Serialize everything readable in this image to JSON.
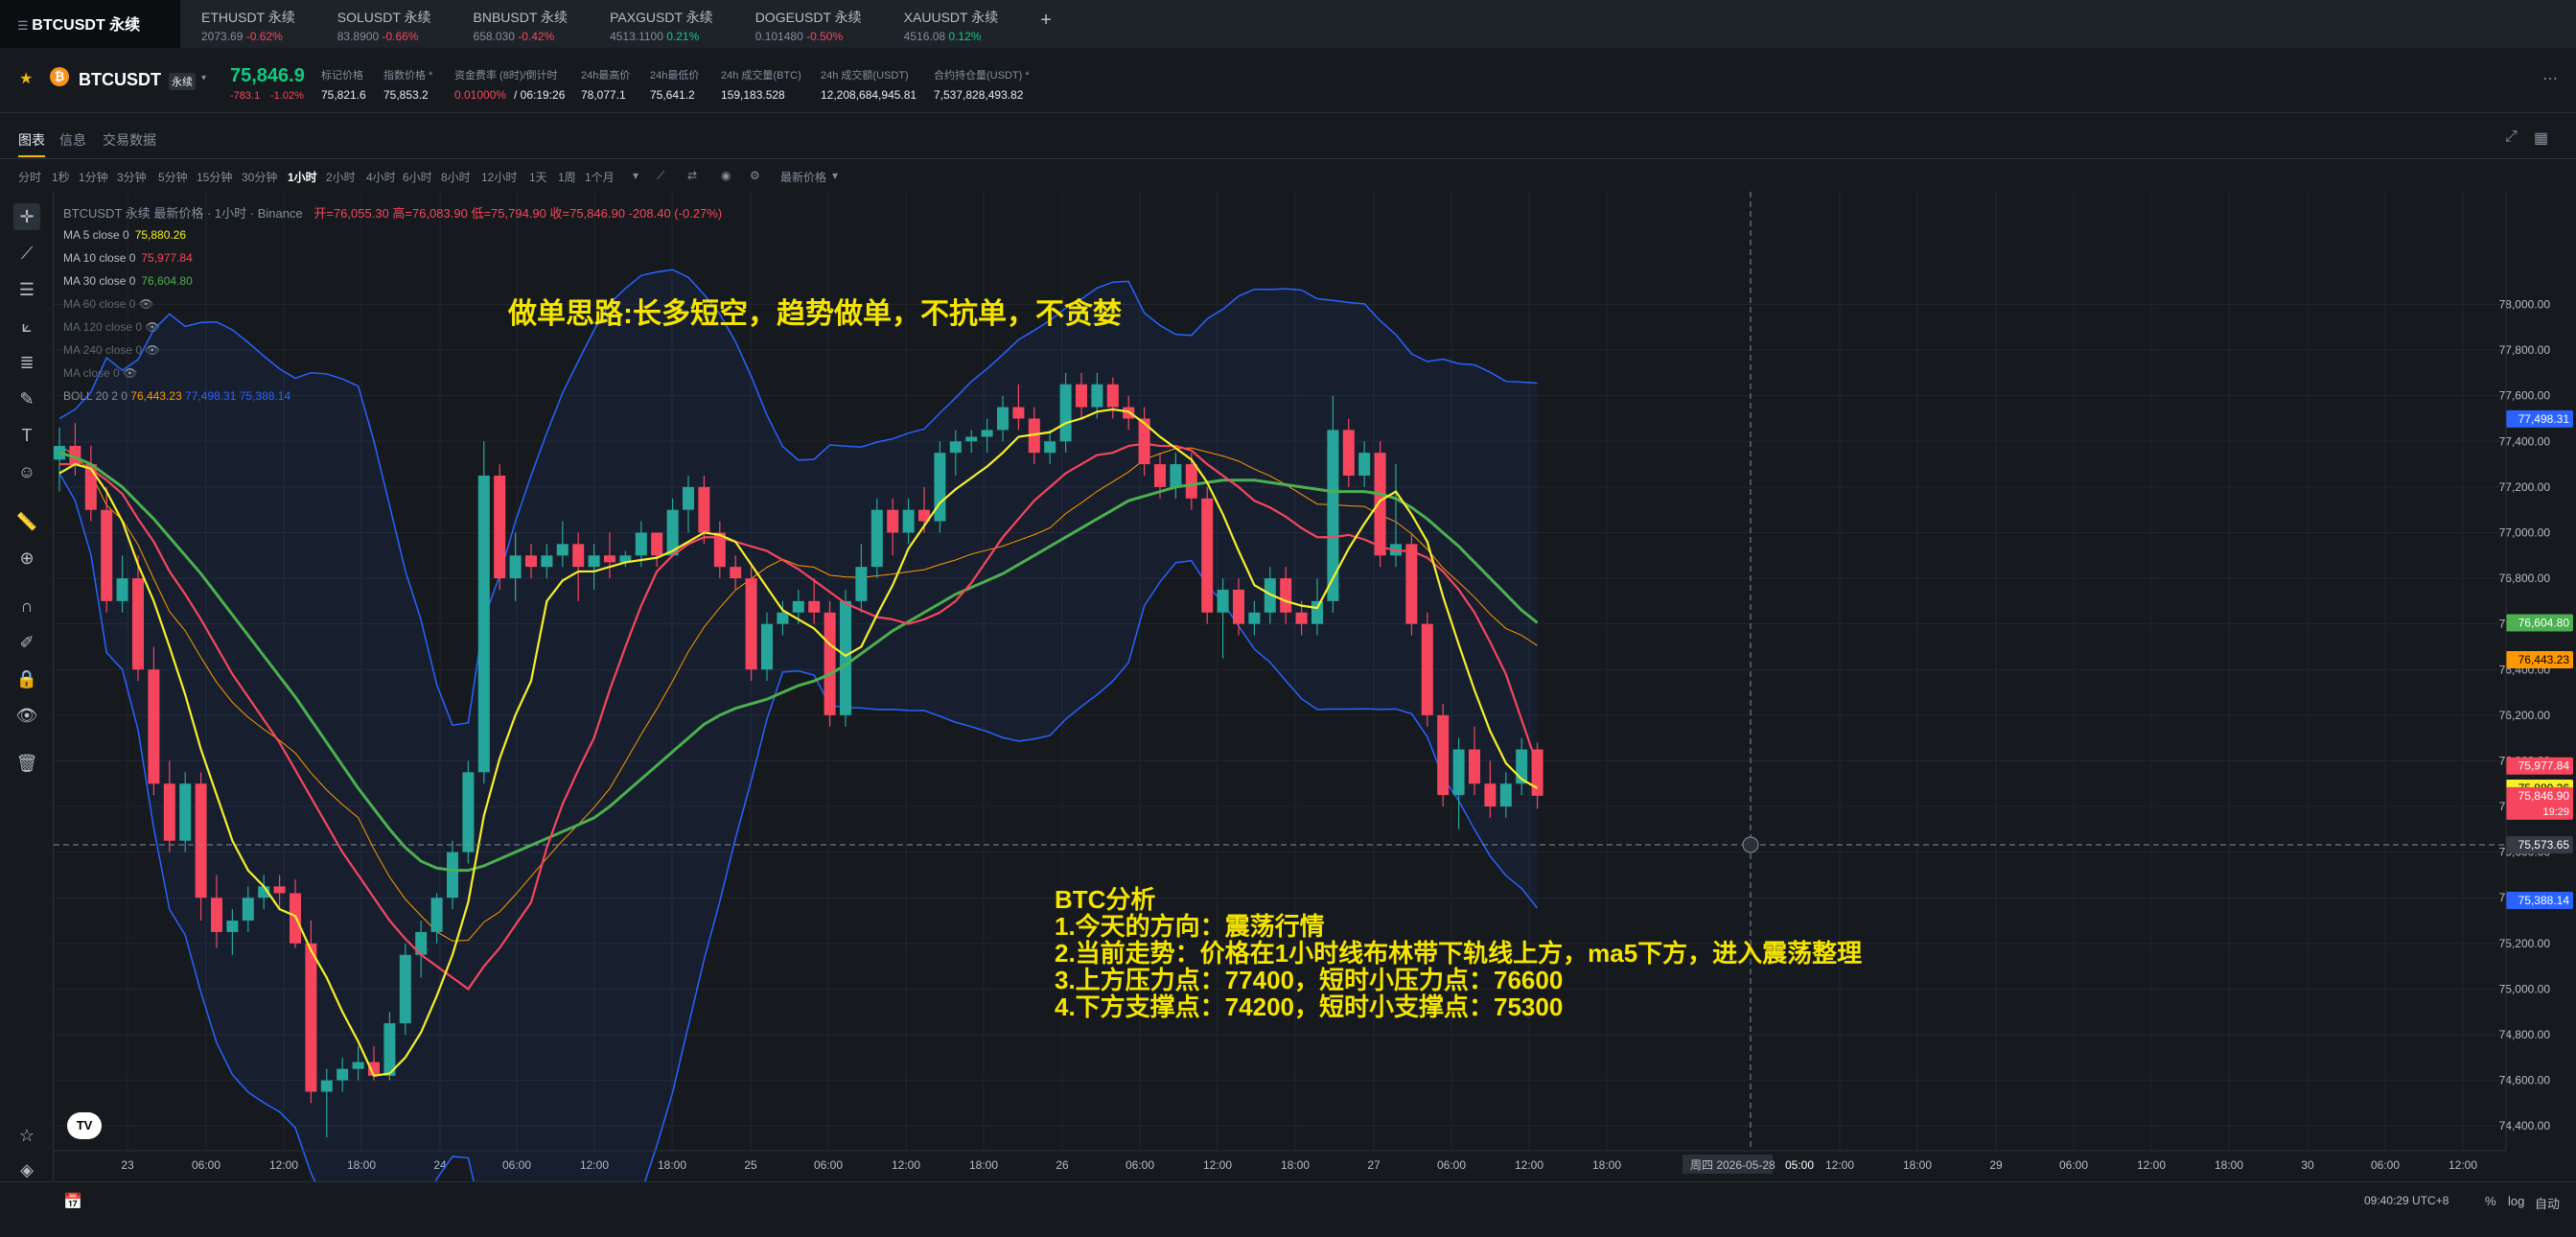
{
  "top_tabs": [
    {
      "symbol": "BTCUSDT 永续",
      "price": "",
      "change": "",
      "dir": "",
      "active": true
    },
    {
      "symbol": "ETHUSDT 永续",
      "price": "2073.69",
      "change": "-0.62%",
      "dir": "down"
    },
    {
      "symbol": "SOLUSDT 永续",
      "price": "83.8900",
      "change": "-0.66%",
      "dir": "down"
    },
    {
      "symbol": "BNBUSDT 永续",
      "price": "658.030",
      "change": "-0.42%",
      "dir": "down"
    },
    {
      "symbol": "PAXGUSDT 永续",
      "price": "4513.1100",
      "change": "0.21%",
      "dir": "up"
    },
    {
      "symbol": "DOGEUSDT 永续",
      "price": "0.101480",
      "change": "-0.50%",
      "dir": "down"
    },
    {
      "symbol": "XAUUSDT 永续",
      "price": "4516.08",
      "change": "0.12%",
      "dir": "up"
    }
  ],
  "ticker": {
    "symbol": "BTCUSDT",
    "badge": "永续",
    "last": "75,846.9",
    "change": "-783.1",
    "change_pct": "-1.02%",
    "stats": [
      {
        "label": "标记价格",
        "value": "75,821.6"
      },
      {
        "label": "指数价格 *",
        "value": "75,853.2"
      },
      {
        "label": "资金费率 (8时)/倒计时",
        "value": "0.01000%",
        "value2": "/ 06:19:26"
      },
      {
        "label": "24h最高价",
        "value": "78,077.1"
      },
      {
        "label": "24h最低价",
        "value": "75,641.2"
      },
      {
        "label": "24h 成交量(BTC)",
        "value": "159,183.528"
      },
      {
        "label": "24h 成交额(USDT)",
        "value": "12,208,684,945.81"
      },
      {
        "label": "合约持仓量(USDT) *",
        "value": "7,537,828,493.82"
      }
    ]
  },
  "view_tabs": [
    "图表",
    "信息",
    "交易数据"
  ],
  "timeframes": [
    "分时",
    "1秒",
    "1分钟",
    "3分钟",
    "5分钟",
    "15分钟",
    "30分钟",
    "1小时",
    "2小时",
    "4小时",
    "6小时",
    "8小时",
    "12小时",
    "1天",
    "1周",
    "1个月"
  ],
  "active_tf": "1小时",
  "price_type": "最新价格",
  "chart_title": "BTCUSDT 永续 最新价格 · 1小时 · Binance",
  "ohlc": {
    "o": "开=76,055.30",
    "h": "高=76,083.90",
    "l": "低=75,794.90",
    "c": "收=75,846.90",
    "chg": "-208.40 (-0.27%)"
  },
  "ma_legend": [
    {
      "label": "MA 5 close 0",
      "value": "75,880.26",
      "color": "#f5f02a",
      "on": true
    },
    {
      "label": "MA 10 close 0",
      "value": "75,977.84",
      "color": "#f6465d",
      "on": true
    },
    {
      "label": "MA 30 close 0",
      "value": "76,604.80",
      "color": "#4caf50",
      "on": true
    },
    {
      "label": "MA 60 close 0",
      "value": "",
      "color": "#848e9c",
      "on": false
    },
    {
      "label": "MA 120 close 0",
      "value": "",
      "color": "#848e9c",
      "on": false
    },
    {
      "label": "MA 240 close 0",
      "value": "",
      "color": "#848e9c",
      "on": false
    },
    {
      "label": "MA close 0",
      "value": "",
      "color": "#848e9c",
      "on": false
    }
  ],
  "boll_legend": {
    "label": "BOLL 20 2 0",
    "mid": "76,443.23",
    "up": "77,498.31",
    "dn": "75,388.14"
  },
  "annotations": {
    "headline": "做单思路:长多短空，趋势做单，不抗单，不贪婪",
    "analysis": [
      "BTC分析",
      "1.今天的方向：震荡行情",
      "2.当前走势：价格在1小时线布林带下轨线上方，ma5下方，进入震荡整理",
      "3.上方压力点：77400，短时小压力点：76600",
      "4.下方支撑点：74200，短时小支撑点：75300"
    ]
  },
  "price_axis": [
    "78,000.00",
    "77,800.00",
    "77,600.00",
    "77,400.00",
    "77,200.00",
    "77,000.00",
    "76,800.00",
    "76,600.00",
    "76,400.00",
    "76,200.00",
    "76,000.00",
    "75,800.00",
    "75,600.00",
    "75,400.00",
    "75,200.00",
    "75,000.00",
    "74,800.00",
    "74,600.00",
    "74,400.00"
  ],
  "price_badges": [
    {
      "value": "77,498.31",
      "price": 77498.31,
      "color": "#2962ff"
    },
    {
      "value": "76,604.80",
      "price": 76604.8,
      "color": "#4caf50"
    },
    {
      "value": "76,443.23",
      "price": 76443.23,
      "color": "#ff9800"
    },
    {
      "value": "75,977.84",
      "price": 75977.84,
      "color": "#f6465d"
    },
    {
      "value": "75,880.26",
      "price": 75880.26,
      "color": "#f5f02a"
    },
    {
      "value": "75,846.90",
      "sub": "19:29",
      "price": 75846.9,
      "color": "#f6465d"
    },
    {
      "value": "75,573.65",
      "price": 75573.65,
      "color": "#363a45"
    },
    {
      "value": "75,388.14",
      "price": 75388.14,
      "color": "#2962ff"
    }
  ],
  "time_axis": [
    "23",
    "06:00",
    "12:00",
    "18:00",
    "24",
    "06:00",
    "12:00",
    "18:00",
    "25",
    "06:00",
    "12:00",
    "18:00",
    "26",
    "06:00",
    "12:00",
    "18:00",
    "27",
    "06:00",
    "12:00",
    "18:00",
    "周四 2026-05-28",
    "05:00",
    "12:00",
    "18:00",
    "29",
    "06:00",
    "12:00",
    "18:00",
    "30",
    "06:00",
    "12:00"
  ],
  "footer": {
    "time": "09:40:29 UTC+8",
    "pct": "%",
    "log": "log",
    "auto": "自动"
  },
  "chart_data": {
    "type": "candlestick",
    "interval": "1h",
    "ylim": [
      74300,
      78250
    ],
    "ohlc": [
      [
        77320,
        77460,
        77180,
        77380
      ],
      [
        77380,
        77480,
        77250,
        77300
      ],
      [
        77300,
        77380,
        77050,
        77100
      ],
      [
        77100,
        77200,
        76650,
        76700
      ],
      [
        76700,
        76900,
        76650,
        76800
      ],
      [
        76800,
        76900,
        76350,
        76400
      ],
      [
        76400,
        76500,
        75850,
        75900
      ],
      [
        75900,
        76000,
        75600,
        75650
      ],
      [
        75650,
        75950,
        75600,
        75900
      ],
      [
        75900,
        75950,
        75300,
        75400
      ],
      [
        75400,
        75500,
        75180,
        75250
      ],
      [
        75250,
        75350,
        75150,
        75300
      ],
      [
        75300,
        75450,
        75250,
        75400
      ],
      [
        75400,
        75500,
        75350,
        75450
      ],
      [
        75450,
        75500,
        75350,
        75420
      ],
      [
        75420,
        75480,
        75180,
        75200
      ],
      [
        75200,
        75300,
        74500,
        74550
      ],
      [
        74550,
        74650,
        74350,
        74600
      ],
      [
        74600,
        74700,
        74550,
        74650
      ],
      [
        74650,
        74750,
        74600,
        74680
      ],
      [
        74680,
        74750,
        74600,
        74620
      ],
      [
        74620,
        74900,
        74600,
        74850
      ],
      [
        74850,
        75200,
        74800,
        75150
      ],
      [
        75150,
        75300,
        75050,
        75250
      ],
      [
        75250,
        75420,
        75200,
        75400
      ],
      [
        75400,
        75650,
        75350,
        75600
      ],
      [
        75600,
        76000,
        75550,
        75950
      ],
      [
        75950,
        77400,
        75900,
        77250
      ],
      [
        77250,
        77300,
        76750,
        76800
      ],
      [
        76800,
        77000,
        76700,
        76900
      ],
      [
        76900,
        76950,
        76800,
        76850
      ],
      [
        76850,
        76950,
        76800,
        76900
      ],
      [
        76900,
        77050,
        76850,
        76950
      ],
      [
        76950,
        77000,
        76700,
        76850
      ],
      [
        76850,
        76950,
        76750,
        76900
      ],
      [
        76900,
        77000,
        76800,
        76870
      ],
      [
        76870,
        76920,
        76850,
        76900
      ],
      [
        76900,
        77050,
        76850,
        77000
      ],
      [
        77000,
        77000,
        76850,
        76900
      ],
      [
        76900,
        77150,
        76900,
        77100
      ],
      [
        77100,
        77250,
        77000,
        77200
      ],
      [
        77200,
        77250,
        76950,
        77000
      ],
      [
        77000,
        77050,
        76800,
        76850
      ],
      [
        76850,
        76900,
        76750,
        76800
      ],
      [
        76800,
        76850,
        76350,
        76400
      ],
      [
        76400,
        76650,
        76350,
        76600
      ],
      [
        76600,
        76700,
        76550,
        76650
      ],
      [
        76650,
        76750,
        76600,
        76700
      ],
      [
        76700,
        76800,
        76600,
        76650
      ],
      [
        76650,
        76700,
        76150,
        76200
      ],
      [
        76200,
        76750,
        76150,
        76700
      ],
      [
        76700,
        76950,
        76650,
        76850
      ],
      [
        76850,
        77150,
        76800,
        77100
      ],
      [
        77100,
        77150,
        76900,
        77000
      ],
      [
        77000,
        77150,
        76950,
        77100
      ],
      [
        77100,
        77200,
        77000,
        77050
      ],
      [
        77050,
        77400,
        77000,
        77350
      ],
      [
        77350,
        77450,
        77250,
        77400
      ],
      [
        77400,
        77450,
        77350,
        77420
      ],
      [
        77420,
        77500,
        77350,
        77450
      ],
      [
        77450,
        77600,
        77400,
        77550
      ],
      [
        77550,
        77650,
        77450,
        77500
      ],
      [
        77500,
        77550,
        77300,
        77350
      ],
      [
        77350,
        77450,
        77300,
        77400
      ],
      [
        77400,
        77700,
        77350,
        77650
      ],
      [
        77650,
        77700,
        77500,
        77550
      ],
      [
        77550,
        77700,
        77500,
        77650
      ],
      [
        77650,
        77680,
        77500,
        77550
      ],
      [
        77550,
        77600,
        77450,
        77500
      ],
      [
        77500,
        77550,
        77250,
        77300
      ],
      [
        77300,
        77350,
        77150,
        77200
      ],
      [
        77200,
        77350,
        77150,
        77300
      ],
      [
        77300,
        77350,
        77100,
        77150
      ],
      [
        77150,
        77200,
        76600,
        76650
      ],
      [
        76650,
        76800,
        76450,
        76750
      ],
      [
        76750,
        76800,
        76550,
        76600
      ],
      [
        76600,
        76700,
        76550,
        76650
      ],
      [
        76650,
        76850,
        76600,
        76800
      ],
      [
        76800,
        76850,
        76600,
        76650
      ],
      [
        76650,
        76700,
        76550,
        76600
      ],
      [
        76600,
        76800,
        76550,
        76700
      ],
      [
        76700,
        77600,
        76650,
        77450
      ],
      [
        77450,
        77500,
        77200,
        77250
      ],
      [
        77250,
        77400,
        77200,
        77350
      ],
      [
        77350,
        77400,
        76850,
        76900
      ],
      [
        76900,
        77300,
        76850,
        76950
      ],
      [
        76950,
        77000,
        76550,
        76600
      ],
      [
        76600,
        76650,
        76150,
        76200
      ],
      [
        76200,
        76250,
        75800,
        75850
      ],
      [
        75850,
        76100,
        75700,
        76050
      ],
      [
        76050,
        76150,
        75850,
        75900
      ],
      [
        75900,
        76000,
        75750,
        75800
      ],
      [
        75800,
        75950,
        75750,
        75900
      ],
      [
        75900,
        76100,
        75850,
        76050
      ],
      [
        76050,
        76080,
        75790,
        75847
      ]
    ],
    "ma5": [
      77260,
      77300,
      77280,
      77180,
      77050,
      76860,
      76700,
      76500,
      76290,
      76050,
      75850,
      75650,
      75520,
      75450,
      75350,
      75320,
      75170,
      75050,
      74900,
      74770,
      74620,
      74630,
      74700,
      74810,
      74970,
      75150,
      75380,
      75760,
      76010,
      76200,
      76350,
      76700,
      76790,
      76830,
      76830,
      76850,
      76870,
      76880,
      76890,
      76920,
      76960,
      77000,
      76990,
      76960,
      76860,
      76760,
      76660,
      76620,
      76580,
      76510,
      76460,
      76500,
      76640,
      76770,
      76930,
      77030,
      77130,
      77190,
      77240,
      77290,
      77350,
      77420,
      77430,
      77440,
      77480,
      77500,
      77530,
      77540,
      77530,
      77480,
      77420,
      77370,
      77320,
      77220,
      77080,
      76920,
      76770,
      76730,
      76700,
      76680,
      76670,
      76800,
      76930,
      77040,
      77140,
      77180,
      77080,
      76960,
      76720,
      76510,
      76310,
      76130,
      75990,
      75920,
      75880
    ],
    "ma10": [
      77300,
      77300,
      77280,
      77230,
      77170,
      77060,
      76960,
      76830,
      76730,
      76620,
      76500,
      76380,
      76280,
      76180,
      76080,
      75960,
      75840,
      75720,
      75600,
      75500,
      75400,
      75300,
      75220,
      75150,
      75100,
      75050,
      75000,
      75100,
      75180,
      75280,
      75380,
      75620,
      75810,
      75960,
      76100,
      76310,
      76500,
      76680,
      76830,
      76900,
      76950,
      76980,
      76980,
      76960,
      76940,
      76920,
      76880,
      76840,
      76790,
      76740,
      76690,
      76660,
      76630,
      76620,
      76600,
      76620,
      76650,
      76700,
      76780,
      76880,
      76980,
      77060,
      77140,
      77200,
      77260,
      77300,
      77340,
      77350,
      77380,
      77390,
      77380,
      77380,
      77360,
      77300,
      77250,
      77200,
      77140,
      77110,
      77070,
      77020,
      76980,
      76980,
      76990,
      76970,
      76940,
      76920,
      76920,
      76890,
      76830,
      76750,
      76650,
      76520,
      76380,
      76180,
      75980
    ],
    "ma30": [
      77350,
      77330,
      77300,
      77250,
      77200,
      77130,
      77060,
      76980,
      76900,
      76820,
      76730,
      76640,
      76550,
      76460,
      76370,
      76280,
      76180,
      76080,
      75980,
      75880,
      75790,
      75700,
      75620,
      75560,
      75530,
      75520,
      75520,
      75540,
      75570,
      75600,
      75630,
      75660,
      75690,
      75720,
      75750,
      75800,
      75860,
      75920,
      75980,
      76040,
      76100,
      76160,
      76200,
      76230,
      76250,
      76270,
      76300,
      76330,
      76350,
      76380,
      76420,
      76470,
      76520,
      76570,
      76610,
      76650,
      76690,
      76730,
      76760,
      76790,
      76820,
      76860,
      76900,
      76940,
      76980,
      77020,
      77060,
      77100,
      77140,
      77160,
      77180,
      77200,
      77210,
      77220,
      77230,
      77230,
      77230,
      77220,
      77210,
      77200,
      77190,
      77180,
      77180,
      77180,
      77170,
      77150,
      77110,
      77060,
      77000,
      76940,
      76870,
      76800,
      76730,
      76660,
      76605
    ]
  }
}
